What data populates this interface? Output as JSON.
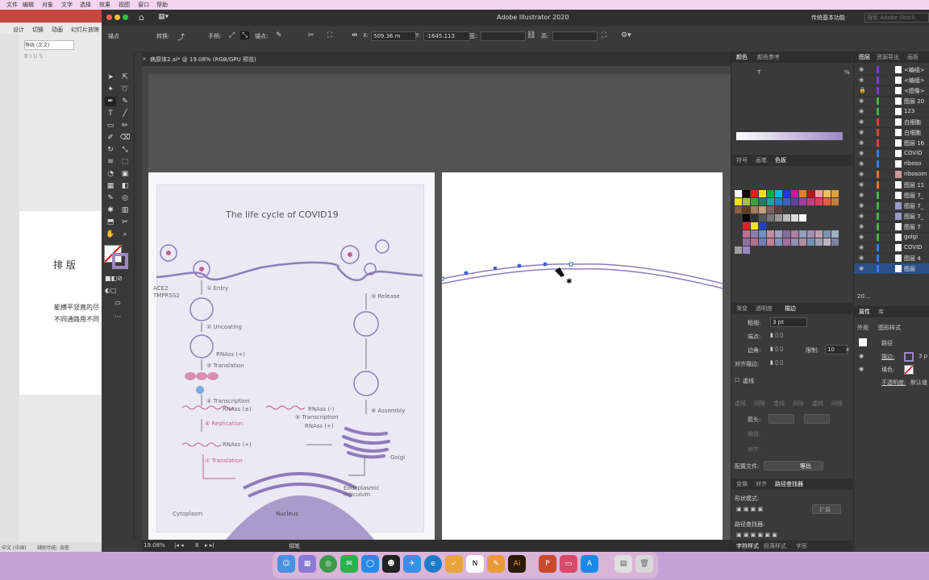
{
  "mac_menu": [
    "文件",
    "编辑",
    "对象",
    "文字",
    "选择",
    "效果",
    "视图",
    "窗口",
    "帮助"
  ],
  "ppt": {
    "tabs": [
      "设计",
      "切换",
      "动画",
      "幻灯片放映"
    ],
    "font_name": "等线 (正文)",
    "slide_title": "排 版",
    "slide_line1": "能横平竖直的尽",
    "slide_line2": "不同通路用不同",
    "status_lang": "中文 (中国)",
    "status_access": "辅助功能: 调查"
  },
  "ai": {
    "app_title": "Adobe Illustrator 2020",
    "workspace": "传统基本功能",
    "search_placeholder": "搜索 Adobe Stock",
    "control": {
      "anchor_label": "锚点",
      "convert_label": "转换:",
      "handle_label": "手柄:",
      "anchor2_label": "锚点:",
      "x_label": "X:",
      "x_value": "509.36 m",
      "y_label": "Y:",
      "y_value": "-1645.113",
      "w_label": "宽:",
      "h_label": "高:"
    },
    "doc_tab": "病原体2.ai* @ 19.08% (RGB/GPU 预览)",
    "status": {
      "zoom": "19.08%",
      "artboard": "8",
      "tool": "钢笔"
    },
    "figure": {
      "title": "The life cycle of COVID19",
      "labels": {
        "ace2": "ACE2",
        "tmprss2": "TMPRSS2",
        "entry": "① Entry",
        "uncoating": "② Uncoating",
        "rnass_plus": "RNAss (+)",
        "translation": "③ Translation",
        "transcription": "④ Transcription",
        "rnass_pm": "RNAss (±)",
        "rnass_minus": "RNAss (-)",
        "transcription2": "⑤ Transcription",
        "rnass_plus2": "RNAss (+)",
        "replication": "⑥ Replication",
        "rnass_plus3": "RNAss (+)",
        "translation2": "⑦ Translation",
        "release": "⑨ Release",
        "assembly": "⑧ Assembly",
        "golgi": "Golgi",
        "er": "Endoplasmic reticulum",
        "cytoplasm": "Cytoplasm",
        "nucleus": "Nucleus"
      }
    },
    "color_panel": {
      "tabs": [
        "颜色",
        "颜色参考"
      ],
      "t_label": "T",
      "pct": "%"
    },
    "swatches_panel": {
      "tabs": [
        "符号",
        "画笔",
        "色板"
      ]
    },
    "stroke_panel": {
      "tabs": [
        "渐变",
        "透明度",
        "描边"
      ],
      "weight_label": "粗细:",
      "weight_value": "3 pt",
      "cap_label": "端点:",
      "corner_label": "边角:",
      "limit_label": "限制:",
      "limit_value": "10",
      "limit_unit": "x",
      "align_label": "对齐描边:",
      "dashed_label": "虚线",
      "dash_labels": [
        "虚线",
        "间隙",
        "虚线",
        "间隙",
        "虚线",
        "间隙"
      ],
      "arrow_label": "箭头:",
      "scale_label": "缩放:",
      "align2_label": "对齐:",
      "profile_label": "配置文件:",
      "profile_value": "等比"
    },
    "pathfinder_panel": {
      "tabs": [
        "变换",
        "对齐",
        "路径查找器"
      ],
      "shape_modes": "形状模式:",
      "expand": "扩展",
      "pathfinders": "路径查找器:"
    },
    "char_panel": {
      "tabs": [
        "字符样式",
        "段落样式",
        "字形"
      ]
    },
    "layers_panel": {
      "tabs": [
        "图层",
        "资源导出",
        "画板"
      ],
      "rows": [
        {
          "name": "<编组>",
          "color": "#7a3fd0"
        },
        {
          "name": "<编组>",
          "color": "#7a3fd0"
        },
        {
          "name": "<图像>",
          "color": "#7a3fd0"
        },
        {
          "name": "图层 20",
          "color": "#4caf50"
        },
        {
          "name": "123",
          "color": "#4caf50"
        },
        {
          "name": "白细胞",
          "color": "#e04040"
        },
        {
          "name": "白细胞",
          "color": "#e04040"
        },
        {
          "name": "图层 16",
          "color": "#e04040"
        },
        {
          "name": "COVID",
          "color": "#3a7be0"
        },
        {
          "name": "riboso",
          "color": "#3a7be0"
        },
        {
          "name": "ribosom",
          "color": "#e07a3a"
        },
        {
          "name": "图层 11",
          "color": "#e07a3a"
        },
        {
          "name": "图层 7_",
          "color": "#4caf50"
        },
        {
          "name": "图层 7_",
          "color": "#4caf50"
        },
        {
          "name": "图层 7_",
          "color": "#4caf50"
        },
        {
          "name": "图层 7",
          "color": "#4caf50"
        },
        {
          "name": "golgi",
          "color": "#4caf50"
        },
        {
          "name": "COVID",
          "color": "#3a7be0"
        },
        {
          "name": "图层 4",
          "color": "#3a7be0"
        },
        {
          "name": "图层",
          "color": "#3a7be0"
        }
      ],
      "count": "20..."
    },
    "props_panel": {
      "tabs": [
        "属性",
        "库"
      ],
      "subtabs": [
        "外观",
        "图形样式"
      ],
      "path_label": "路径",
      "stroke_label": "描边:",
      "stroke_value": "3 p",
      "fill_label": "填色:",
      "opacity_label": "不透明度:",
      "opacity_value": "默认值"
    }
  },
  "dock_apps": [
    "Finder",
    "Launchpad",
    "Chrome",
    "WeChat",
    "QQ浏览器",
    "QQ",
    "Mail",
    "Edge",
    "Todo",
    "Notion",
    "Pages",
    "Illustrator",
    "PowerPoint",
    "Keynote",
    "App Store",
    "Preview",
    "Trash"
  ]
}
